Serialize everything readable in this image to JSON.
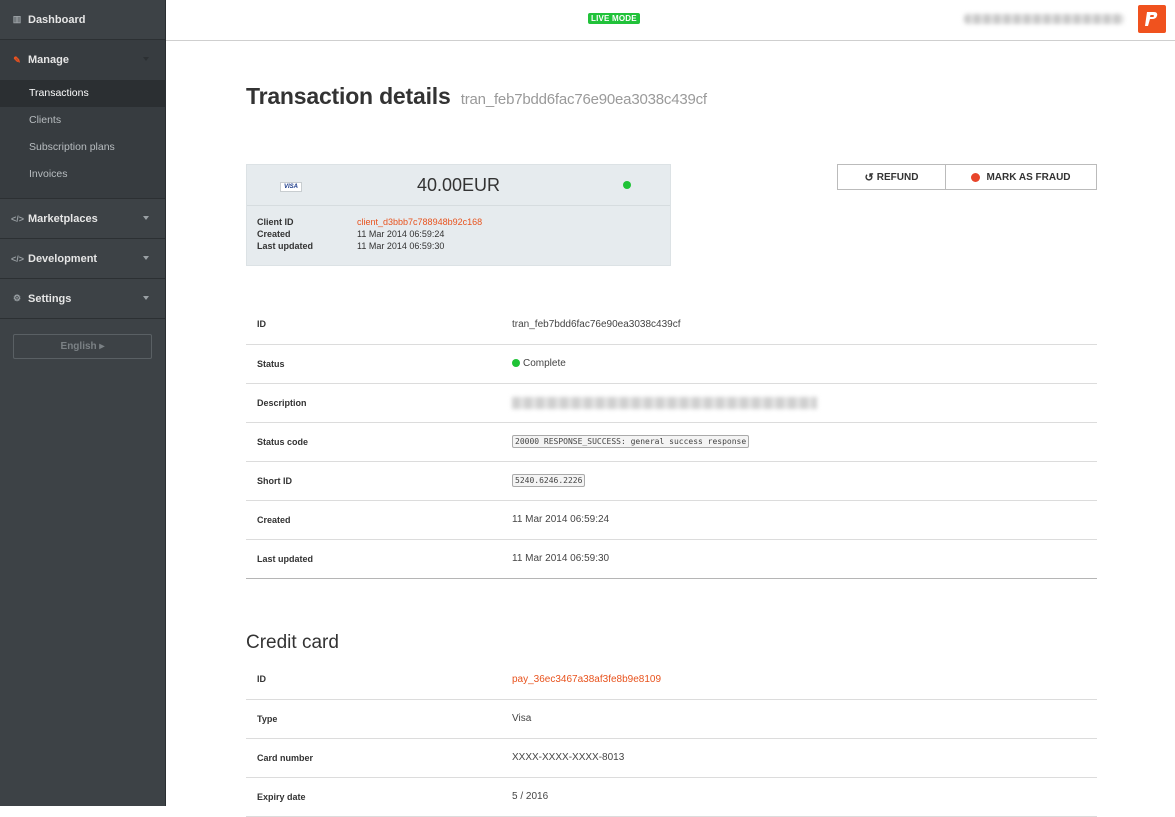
{
  "sidebar": {
    "dashboard": "Dashboard",
    "manage": "Manage",
    "manage_items": [
      "Transactions",
      "Clients",
      "Subscription plans",
      "Invoices"
    ],
    "marketplaces": "Marketplaces",
    "development": "Development",
    "settings": "Settings",
    "language": "English ▸"
  },
  "topbar": {
    "mode_badge": "LIVE MODE",
    "brand_color": "#f0521e"
  },
  "page": {
    "title": "Transaction details",
    "transaction_id": "tran_feb7bdd6fac76e90ea3038c439cf"
  },
  "summary_card": {
    "card_brand": "VISA",
    "amount": "40.00EUR",
    "rows": [
      {
        "label": "Client ID",
        "value": "client_d3bbb7c788948b92c168"
      },
      {
        "label": "Created",
        "value": "11 Mar 2014 06:59:24"
      },
      {
        "label": "Last updated",
        "value": "11 Mar 2014 06:59:30"
      }
    ]
  },
  "actions": {
    "refund": "REFUND",
    "mark_fraud": "MARK AS FRAUD"
  },
  "details": [
    {
      "label": "ID",
      "value": "tran_feb7bdd6fac76e90ea3038c439cf"
    },
    {
      "label": "Status",
      "value": "Complete"
    },
    {
      "label": "Description",
      "value": ""
    },
    {
      "label": "Status code",
      "value": "20000 RESPONSE_SUCCESS: general success response"
    },
    {
      "label": "Short ID",
      "value": "5240.6246.2226"
    },
    {
      "label": "Created",
      "value": "11 Mar 2014 06:59:24"
    },
    {
      "label": "Last updated",
      "value": "11 Mar 2014 06:59:30"
    }
  ],
  "credit_card": {
    "heading": "Credit card",
    "rows": [
      {
        "label": "ID",
        "value": "pay_36ec3467a38af3fe8b9e8109"
      },
      {
        "label": "Type",
        "value": "Visa"
      },
      {
        "label": "Card number",
        "value": "XXXX-XXXX-XXXX-8013"
      },
      {
        "label": "Expiry date",
        "value": "5 / 2016"
      }
    ]
  }
}
